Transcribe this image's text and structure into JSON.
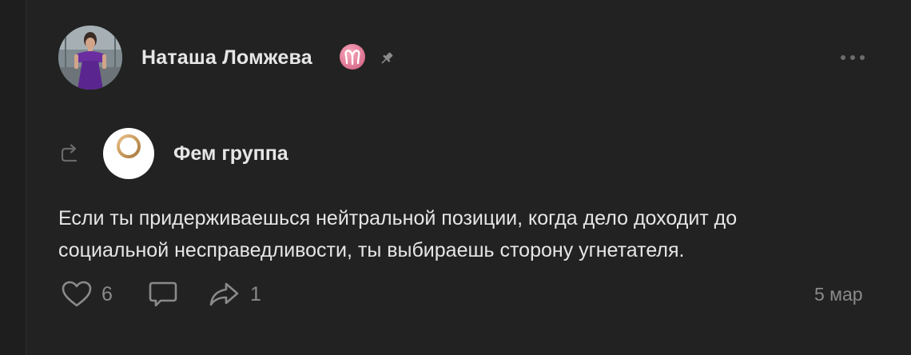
{
  "post": {
    "author": {
      "name": "Наташа Ломжева",
      "avatar_icon": "profile-photo",
      "zodiac_icon": "aries-sign-icon",
      "zodiac_symbol": "♈",
      "pinned_icon": "pin-icon"
    },
    "more_icon": "ellipsis-icon",
    "repost": {
      "icon": "repost-arrow-icon",
      "group_name": "Фем группа",
      "group_avatar_icon": "venus-symbol-icon"
    },
    "text_lines": [
      "Если ты придерживаешься нейтральной позиции, когда дело доходит до",
      "социальной несправедливости, ты выбираешь сторону угнетателя."
    ],
    "actions": {
      "likes_count": "6",
      "shares_count": "1"
    },
    "date": "5 мар"
  },
  "colors": {
    "background": "#222222",
    "text": "#e6e6e6",
    "muted": "#8a8a8a",
    "accent_zodiac": "#e07896",
    "venus_gold": "#c99a5b"
  }
}
